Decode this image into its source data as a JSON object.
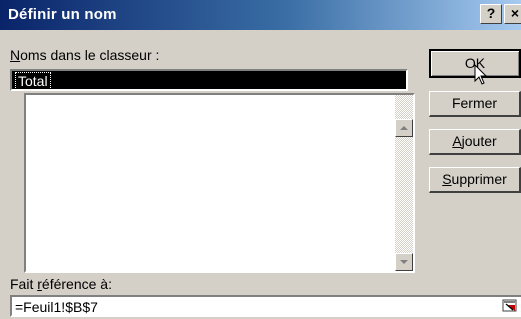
{
  "dialog": {
    "title": "Définir un nom",
    "help_glyph": "?",
    "close_glyph": "×"
  },
  "names_label": {
    "access_key": "N",
    "rest": "oms dans le classeur :"
  },
  "name_input": {
    "value": "Total"
  },
  "names_list": {
    "items": []
  },
  "reference_label": {
    "before": "Fait ",
    "access_key": "r",
    "after": "éférence à:"
  },
  "reference_input": {
    "value": "=Feuil1!$B$7"
  },
  "buttons": {
    "ok": "OK",
    "close": "Fermer",
    "add_key": "A",
    "add_rest": "jouter",
    "delete_key": "S",
    "delete_rest": "upprimer"
  },
  "icons": {
    "help": "help-icon",
    "close": "close-icon",
    "scroll_up": "scroll-up-arrow-icon",
    "scroll_down": "scroll-down-arrow-icon",
    "collapse": "collapse-dialog-icon",
    "cursor": "mouse-pointer-icon"
  }
}
